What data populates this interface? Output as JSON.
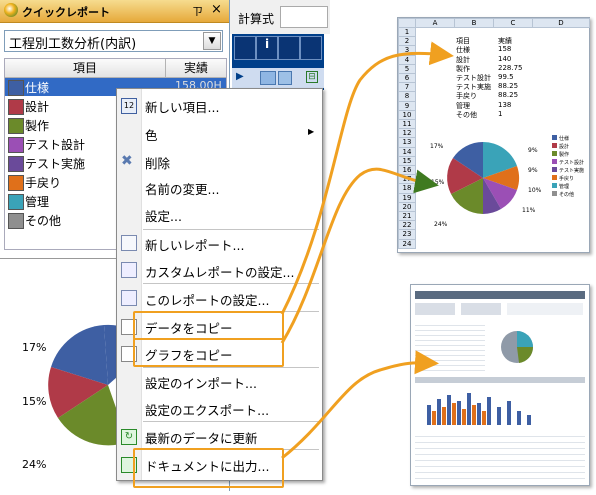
{
  "panel": {
    "title": "クイックレポート",
    "pin_icon": "pin-icon",
    "close_icon": "close-icon",
    "dropdown_value": "工程別工数分析(内訳)",
    "columns": [
      "項目",
      "実績"
    ],
    "rows": [
      {
        "label": "仕様",
        "value": "158.00H",
        "color": "#3e5fa3"
      },
      {
        "label": "設計",
        "value": "",
        "color": "#b03a48"
      },
      {
        "label": "製作",
        "value": "",
        "color": "#6b8a2a"
      },
      {
        "label": "テスト設計",
        "value": "",
        "color": "#9b4fb5"
      },
      {
        "label": "テスト実施",
        "value": "",
        "color": "#6a4a9a"
      },
      {
        "label": "手戻り",
        "value": "",
        "color": "#e0701a"
      },
      {
        "label": "管理",
        "value": "",
        "color": "#3aa3b8"
      },
      {
        "label": "その他",
        "value": "",
        "color": "#8f8f8f"
      }
    ],
    "pie_labels": [
      "17%",
      "15%",
      "24%"
    ]
  },
  "toolbar": {
    "calc_label": "計算式"
  },
  "menu": {
    "items": [
      "新しい項目...",
      "色",
      "削除",
      "名前の変更...",
      "設定...",
      "新しいレポート...",
      "カスタムレポートの設定...",
      "このレポートの設定...",
      "データをコピー",
      "グラフをコピー",
      "設定のインポート...",
      "設定のエクスポート...",
      "最新のデータに更新",
      "ドキュメントに出力..."
    ]
  },
  "sheet": {
    "col_headers": [
      "A",
      "B",
      "C",
      "D"
    ],
    "row_numbers": [
      "1",
      "2",
      "3",
      "4",
      "5",
      "6",
      "7",
      "8",
      "9",
      "10",
      "11",
      "12",
      "13",
      "14",
      "15",
      "16",
      "17",
      "18",
      "19",
      "20",
      "21",
      "22",
      "23",
      "24"
    ],
    "table": [
      [
        "項目",
        "実績"
      ],
      [
        "仕様",
        "158"
      ],
      [
        "設計",
        "140"
      ],
      [
        "製作",
        "228.75"
      ],
      [
        "テスト設計",
        "99.5"
      ],
      [
        "テスト実施",
        "88.25"
      ],
      [
        "手戻り",
        "88.25"
      ],
      [
        "管理",
        "138"
      ],
      [
        "その他",
        "1"
      ]
    ],
    "pie_pct": [
      "17%",
      "15%",
      "24%",
      "9%",
      "9%",
      "10%",
      "11%"
    ],
    "legend": [
      "仕様",
      "設計",
      "製作",
      "テスト設計",
      "テスト実施",
      "手戻り",
      "管理",
      "その他"
    ]
  },
  "accent": "#f0a020"
}
